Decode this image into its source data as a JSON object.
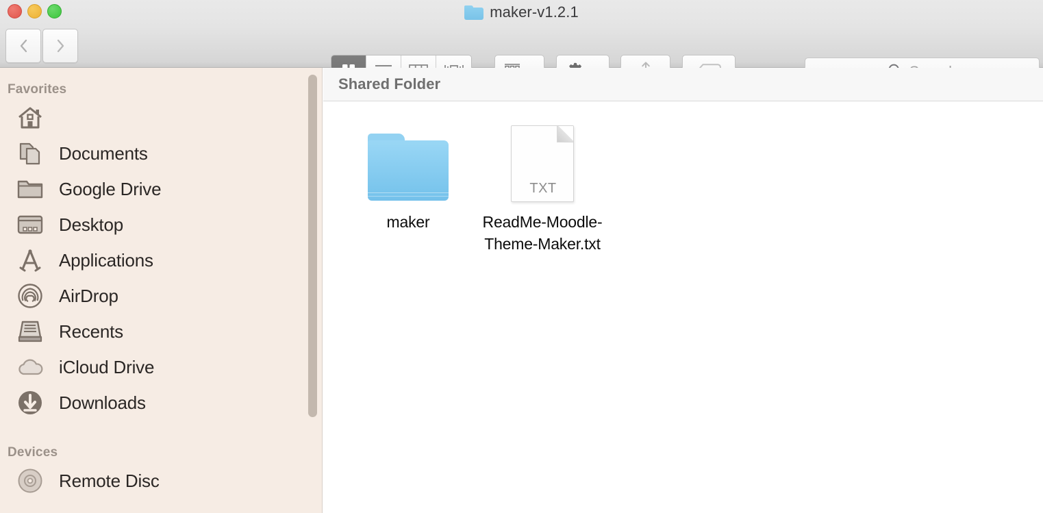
{
  "window": {
    "title": "maker-v1.2.1",
    "traffic_lights": {
      "close_label": "close",
      "minimize_label": "minimize",
      "maximize_label": "maximize"
    }
  },
  "toolbar": {
    "back_label": "Back",
    "forward_label": "Forward",
    "view_modes": [
      {
        "id": "icon",
        "label": "Icon View",
        "active": true
      },
      {
        "id": "list",
        "label": "List View",
        "active": false
      },
      {
        "id": "column",
        "label": "Column View",
        "active": false
      },
      {
        "id": "gallery",
        "label": "Gallery View",
        "active": false
      }
    ],
    "arrange_label": "Arrange By",
    "action_label": "Action",
    "share_label": "Share",
    "tag_label": "Tags"
  },
  "search": {
    "placeholder": "Search",
    "value": ""
  },
  "sidebar": {
    "sections": [
      {
        "title": "Favorites",
        "items": [
          {
            "label": "",
            "icon": "home-icon"
          },
          {
            "label": "Documents",
            "icon": "documents-icon"
          },
          {
            "label": "Google Drive",
            "icon": "folder-icon"
          },
          {
            "label": "Desktop",
            "icon": "desktop-icon"
          },
          {
            "label": "Applications",
            "icon": "applications-icon"
          },
          {
            "label": "AirDrop",
            "icon": "airdrop-icon"
          },
          {
            "label": "Recents",
            "icon": "recents-icon"
          },
          {
            "label": "iCloud Drive",
            "icon": "icloud-icon"
          },
          {
            "label": "Downloads",
            "icon": "downloads-icon"
          }
        ]
      },
      {
        "title": "Devices",
        "items": [
          {
            "label": "Remote Disc",
            "icon": "disc-icon"
          }
        ]
      }
    ]
  },
  "content": {
    "header_title": "Shared Folder",
    "items": [
      {
        "name": "maker",
        "type": "folder"
      },
      {
        "name": "ReadMe-Moodle-Theme-Maker.txt",
        "type": "txt",
        "ext_badge": "TXT"
      }
    ]
  },
  "colors": {
    "sidebar_bg": "#f6ece4",
    "folder_blue": "#8acef1",
    "toolbar_bg": "#e4e4e4",
    "active_view_bg": "#757575"
  }
}
